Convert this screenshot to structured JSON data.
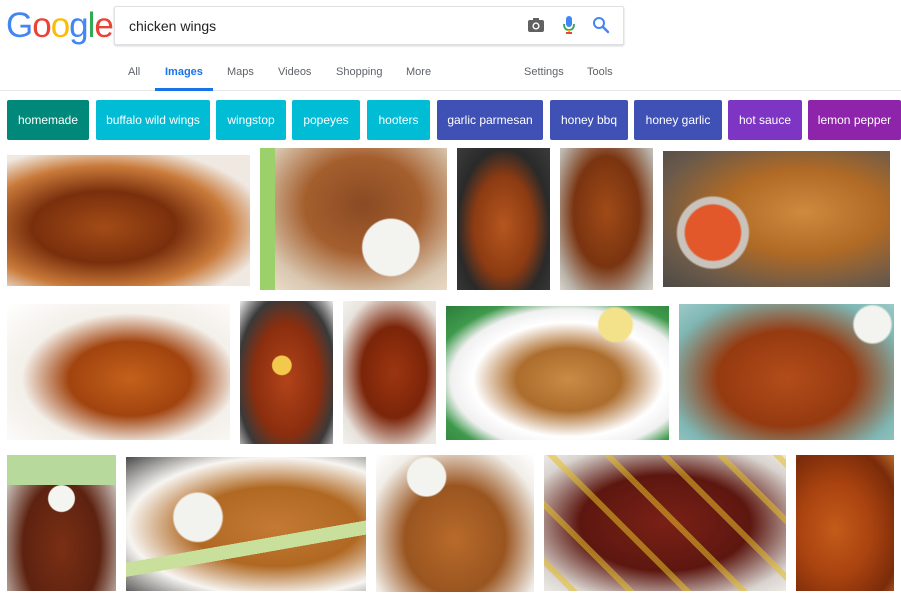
{
  "logo": {
    "letters": [
      "G",
      "o",
      "o",
      "g",
      "l",
      "e"
    ],
    "colors": [
      "#4285f4",
      "#ea4335",
      "#fbbc05",
      "#4285f4",
      "#34a853",
      "#ea4335"
    ]
  },
  "search": {
    "query": "chicken wings",
    "camera_icon": "camera-icon",
    "mic_icon": "mic-icon",
    "search_icon": "search-icon"
  },
  "tabs": {
    "all": "All",
    "images": "Images",
    "maps": "Maps",
    "videos": "Videos",
    "shopping": "Shopping",
    "more": "More",
    "settings": "Settings",
    "tools": "Tools"
  },
  "chips": [
    {
      "label": "homemade",
      "color": "#00897b"
    },
    {
      "label": "buffalo wild wings",
      "color": "#00bcd4"
    },
    {
      "label": "wingstop",
      "color": "#00bcd4"
    },
    {
      "label": "popeyes",
      "color": "#00bcd4"
    },
    {
      "label": "hooters",
      "color": "#00bcd4"
    },
    {
      "label": "garlic parmesan",
      "color": "#3f51b5"
    },
    {
      "label": "honey bbq",
      "color": "#3f51b5"
    },
    {
      "label": "honey garlic",
      "color": "#3f51b5"
    },
    {
      "label": "hot sauce",
      "color": "#7e35c4"
    },
    {
      "label": "lemon pepper",
      "color": "#8e24aa"
    }
  ]
}
